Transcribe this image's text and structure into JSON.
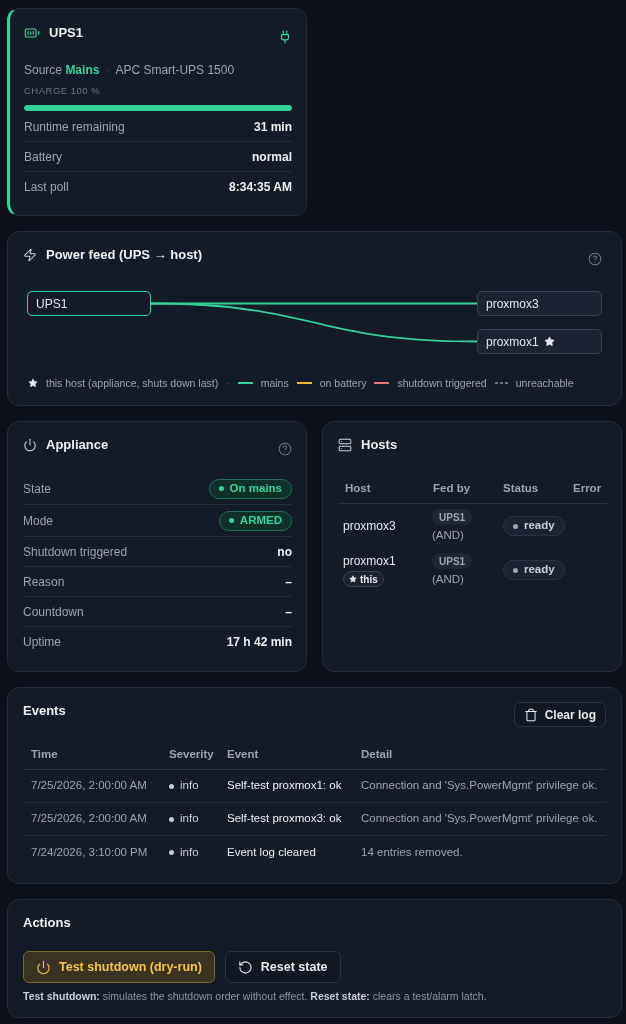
{
  "ups": {
    "name": "UPS1",
    "on_mains": true,
    "source_label": "Source",
    "source": "Mains",
    "separator": "·",
    "model": "APC Smart-UPS 1500",
    "charge_label": "CHARGE 100 %",
    "level": 1,
    "rows": [
      {
        "label": "Runtime remaining",
        "value": "31 min"
      },
      {
        "label": "Battery",
        "value": "normal"
      },
      {
        "label": "Last poll",
        "value": "8:34:35 AM"
      }
    ]
  },
  "power_feed": {
    "title": "Power feed (UPS → host)",
    "source_node": {
      "label": "UPS1"
    },
    "hosts": [
      {
        "label": "proxmox3",
        "this_host": false,
        "color": "#34d399"
      },
      {
        "label": "proxmox1",
        "this_host": true,
        "color": "#34d399"
      }
    ],
    "legend": [
      {
        "kind": "star",
        "label": "this host (appliance, shuts down last)"
      },
      {
        "kind": "separator",
        "label": "·"
      },
      {
        "kind": "line",
        "color": "#34d399",
        "label": "mains"
      },
      {
        "kind": "line",
        "color": "#f5b82e",
        "label": "on battery"
      },
      {
        "kind": "line",
        "color": "#f0717a",
        "label": "shutdown triggered"
      },
      {
        "kind": "dashed",
        "color": "#6b7280",
        "label": "unreachable"
      }
    ]
  },
  "appliance": {
    "title": "Appliance",
    "rows": [
      {
        "kind": "pill",
        "label": "State",
        "value": "On mains"
      },
      {
        "kind": "pill",
        "label": "Mode",
        "value": "ARMED"
      },
      {
        "kind": "text",
        "label": "Shutdown triggered",
        "value": "no"
      },
      {
        "kind": "text",
        "label": "Reason",
        "value": "–"
      },
      {
        "kind": "text",
        "label": "Countdown",
        "value": "–"
      },
      {
        "kind": "text",
        "label": "Uptime",
        "value": "17 h 42 min"
      }
    ]
  },
  "hosts": {
    "title": "Hosts",
    "columns": [
      "Host",
      "Fed by",
      "Status",
      "Error"
    ],
    "rows": [
      {
        "host": "proxmox3",
        "this_host": false,
        "fed_by": "UPS1",
        "fed_mode": "(AND)",
        "status": "ready"
      },
      {
        "host": "proxmox1",
        "this_host": true,
        "tag": "this",
        "fed_by": "UPS1",
        "fed_mode": "(AND)",
        "status": "ready"
      }
    ]
  },
  "events": {
    "title": "Events",
    "clear_button": "Clear log",
    "columns": [
      "Time",
      "Severity",
      "Event",
      "Detail"
    ],
    "rows": [
      {
        "time": "7/25/2026, 2:00:00 AM",
        "severity": "info",
        "event": "Self-test proxmox1: ok",
        "detail": "Connection and 'Sys.PowerMgmt' privilege ok."
      },
      {
        "time": "7/25/2026, 2:00:00 AM",
        "severity": "info",
        "event": "Self-test proxmox3: ok",
        "detail": "Connection and 'Sys.PowerMgmt' privilege ok."
      },
      {
        "time": "7/24/2026, 3:10:00 PM",
        "severity": "info",
        "event": "Event log cleared",
        "detail": "14 entries removed."
      }
    ]
  },
  "actions": {
    "title": "Actions",
    "buttons": [
      {
        "kind": "warning",
        "label": "Test shutdown (dry-run)"
      },
      {
        "kind": "default",
        "label": "Reset state"
      }
    ],
    "note": "**Test shutdown:** simulates the shutdown order without effect. **Reset state:** clears a test/alarm latch."
  }
}
